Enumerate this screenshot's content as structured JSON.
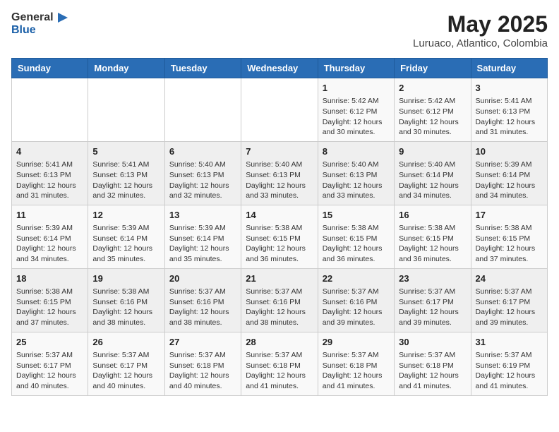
{
  "header": {
    "logo_general": "General",
    "logo_blue": "Blue",
    "month": "May 2025",
    "location": "Luruaco, Atlantico, Colombia"
  },
  "weekdays": [
    "Sunday",
    "Monday",
    "Tuesday",
    "Wednesday",
    "Thursday",
    "Friday",
    "Saturday"
  ],
  "weeks": [
    [
      {
        "day": "",
        "info": ""
      },
      {
        "day": "",
        "info": ""
      },
      {
        "day": "",
        "info": ""
      },
      {
        "day": "",
        "info": ""
      },
      {
        "day": "1",
        "info": "Sunrise: 5:42 AM\nSunset: 6:12 PM\nDaylight: 12 hours\nand 30 minutes."
      },
      {
        "day": "2",
        "info": "Sunrise: 5:42 AM\nSunset: 6:12 PM\nDaylight: 12 hours\nand 30 minutes."
      },
      {
        "day": "3",
        "info": "Sunrise: 5:41 AM\nSunset: 6:13 PM\nDaylight: 12 hours\nand 31 minutes."
      }
    ],
    [
      {
        "day": "4",
        "info": "Sunrise: 5:41 AM\nSunset: 6:13 PM\nDaylight: 12 hours\nand 31 minutes."
      },
      {
        "day": "5",
        "info": "Sunrise: 5:41 AM\nSunset: 6:13 PM\nDaylight: 12 hours\nand 32 minutes."
      },
      {
        "day": "6",
        "info": "Sunrise: 5:40 AM\nSunset: 6:13 PM\nDaylight: 12 hours\nand 32 minutes."
      },
      {
        "day": "7",
        "info": "Sunrise: 5:40 AM\nSunset: 6:13 PM\nDaylight: 12 hours\nand 33 minutes."
      },
      {
        "day": "8",
        "info": "Sunrise: 5:40 AM\nSunset: 6:13 PM\nDaylight: 12 hours\nand 33 minutes."
      },
      {
        "day": "9",
        "info": "Sunrise: 5:40 AM\nSunset: 6:14 PM\nDaylight: 12 hours\nand 34 minutes."
      },
      {
        "day": "10",
        "info": "Sunrise: 5:39 AM\nSunset: 6:14 PM\nDaylight: 12 hours\nand 34 minutes."
      }
    ],
    [
      {
        "day": "11",
        "info": "Sunrise: 5:39 AM\nSunset: 6:14 PM\nDaylight: 12 hours\nand 34 minutes."
      },
      {
        "day": "12",
        "info": "Sunrise: 5:39 AM\nSunset: 6:14 PM\nDaylight: 12 hours\nand 35 minutes."
      },
      {
        "day": "13",
        "info": "Sunrise: 5:39 AM\nSunset: 6:14 PM\nDaylight: 12 hours\nand 35 minutes."
      },
      {
        "day": "14",
        "info": "Sunrise: 5:38 AM\nSunset: 6:15 PM\nDaylight: 12 hours\nand 36 minutes."
      },
      {
        "day": "15",
        "info": "Sunrise: 5:38 AM\nSunset: 6:15 PM\nDaylight: 12 hours\nand 36 minutes."
      },
      {
        "day": "16",
        "info": "Sunrise: 5:38 AM\nSunset: 6:15 PM\nDaylight: 12 hours\nand 36 minutes."
      },
      {
        "day": "17",
        "info": "Sunrise: 5:38 AM\nSunset: 6:15 PM\nDaylight: 12 hours\nand 37 minutes."
      }
    ],
    [
      {
        "day": "18",
        "info": "Sunrise: 5:38 AM\nSunset: 6:15 PM\nDaylight: 12 hours\nand 37 minutes."
      },
      {
        "day": "19",
        "info": "Sunrise: 5:38 AM\nSunset: 6:16 PM\nDaylight: 12 hours\nand 38 minutes."
      },
      {
        "day": "20",
        "info": "Sunrise: 5:37 AM\nSunset: 6:16 PM\nDaylight: 12 hours\nand 38 minutes."
      },
      {
        "day": "21",
        "info": "Sunrise: 5:37 AM\nSunset: 6:16 PM\nDaylight: 12 hours\nand 38 minutes."
      },
      {
        "day": "22",
        "info": "Sunrise: 5:37 AM\nSunset: 6:16 PM\nDaylight: 12 hours\nand 39 minutes."
      },
      {
        "day": "23",
        "info": "Sunrise: 5:37 AM\nSunset: 6:17 PM\nDaylight: 12 hours\nand 39 minutes."
      },
      {
        "day": "24",
        "info": "Sunrise: 5:37 AM\nSunset: 6:17 PM\nDaylight: 12 hours\nand 39 minutes."
      }
    ],
    [
      {
        "day": "25",
        "info": "Sunrise: 5:37 AM\nSunset: 6:17 PM\nDaylight: 12 hours\nand 40 minutes."
      },
      {
        "day": "26",
        "info": "Sunrise: 5:37 AM\nSunset: 6:17 PM\nDaylight: 12 hours\nand 40 minutes."
      },
      {
        "day": "27",
        "info": "Sunrise: 5:37 AM\nSunset: 6:18 PM\nDaylight: 12 hours\nand 40 minutes."
      },
      {
        "day": "28",
        "info": "Sunrise: 5:37 AM\nSunset: 6:18 PM\nDaylight: 12 hours\nand 41 minutes."
      },
      {
        "day": "29",
        "info": "Sunrise: 5:37 AM\nSunset: 6:18 PM\nDaylight: 12 hours\nand 41 minutes."
      },
      {
        "day": "30",
        "info": "Sunrise: 5:37 AM\nSunset: 6:18 PM\nDaylight: 12 hours\nand 41 minutes."
      },
      {
        "day": "31",
        "info": "Sunrise: 5:37 AM\nSunset: 6:19 PM\nDaylight: 12 hours\nand 41 minutes."
      }
    ]
  ]
}
